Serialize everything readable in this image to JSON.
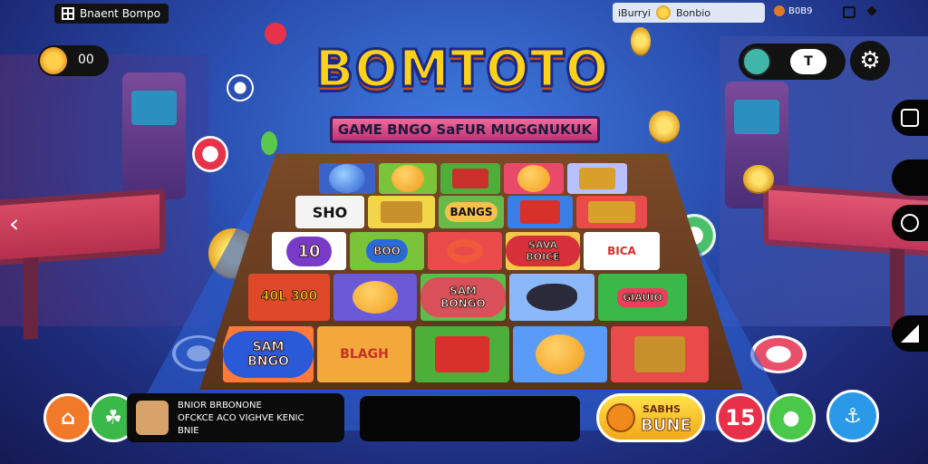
{
  "topbar": {
    "app_title": "Bnaent Bompo",
    "search_text": "iBurryi",
    "balance_text": "Bonbio",
    "status_text": "B0B9"
  },
  "coins": {
    "value": "00"
  },
  "logo": {
    "title": "BOMTOTO",
    "subtitle": "GAME BNGO SaFUR MUGGNUKUK"
  },
  "profile": {
    "tag_label": "T"
  },
  "board": {
    "cells": [
      {
        "text": "SHO"
      },
      {
        "text": "BANGS"
      },
      {
        "text": "10"
      },
      {
        "text": "BOO"
      },
      {
        "text": "SAVA BOICE"
      },
      {
        "text": "BICA"
      },
      {
        "text": "40L 300"
      },
      {
        "text": "SAM BONGO"
      },
      {
        "text": "GIAUIO"
      },
      {
        "text": "SAM BNGO"
      },
      {
        "text": "BLAGH"
      }
    ]
  },
  "player": {
    "line1": "BNIOR BRBONONE",
    "line2": "OFCKCE ACO VIGHVE KENIC",
    "line3": "BNIE"
  },
  "bonus": {
    "top": "SABHS",
    "main": "BUNE"
  },
  "round_badge": "15",
  "colors": {
    "accent": "#ffd21a",
    "primary_bg": "#2a4fb0",
    "board_brown": "#7a4a28"
  }
}
